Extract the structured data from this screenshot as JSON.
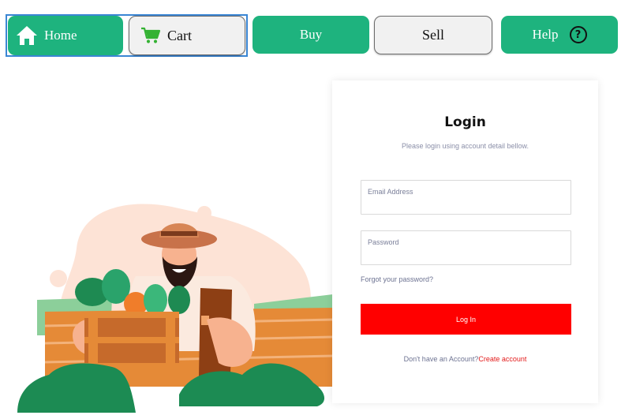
{
  "nav": {
    "home_label": "Home",
    "cart_label": "Cart",
    "buy_label": "Buy",
    "sell_label": "Sell",
    "help_label": "Help",
    "help_icon_glyph": "?",
    "icons": {
      "home": "home-icon",
      "cart": "cart-icon",
      "help": "question-circle-icon"
    },
    "colors": {
      "primary": "#1eb37e",
      "secondary_bg": "#f1f1f1",
      "cart_icon": "#34b233",
      "selection_border": "#3a86d4"
    }
  },
  "login": {
    "title": "Login",
    "subtitle": "Please login using account detail bellow.",
    "email_placeholder": "Email Address",
    "password_placeholder": "Password",
    "forgot_link": "Forgot your password?",
    "login_button": "Log In",
    "no_account_text": "Don't have an Account?",
    "create_account_link": "Create account",
    "colors": {
      "button": "#ff0000",
      "link": "#e31b1b"
    }
  },
  "illustration": {
    "subject": "farmer-with-vegetable-crate"
  }
}
